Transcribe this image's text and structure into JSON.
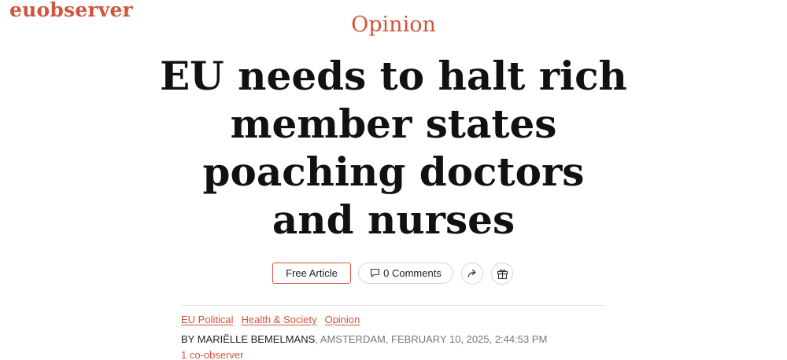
{
  "site": {
    "logo_text": "euobserver"
  },
  "article": {
    "kicker": "Opinion",
    "headline_lines": [
      "EU needs to halt rich",
      "member states",
      "poaching doctors",
      "and nurses"
    ]
  },
  "actions": {
    "free_article_label": "Free Article",
    "comments_label": "0 Comments",
    "share_icon": "share-arrow-icon",
    "gift_icon": "gift-icon"
  },
  "tags": [
    "EU Political",
    "Health & Society",
    "Opinion"
  ],
  "byline": {
    "author": "BY MARIËLLE BEMELMANS",
    "meta": ", AMSTERDAM, FEBRUARY 10, 2025, 2:44:53 PM"
  },
  "co_observer": "1 co-observer",
  "colors": {
    "accent": "#d0553c",
    "text": "#111111",
    "muted": "#777777"
  }
}
